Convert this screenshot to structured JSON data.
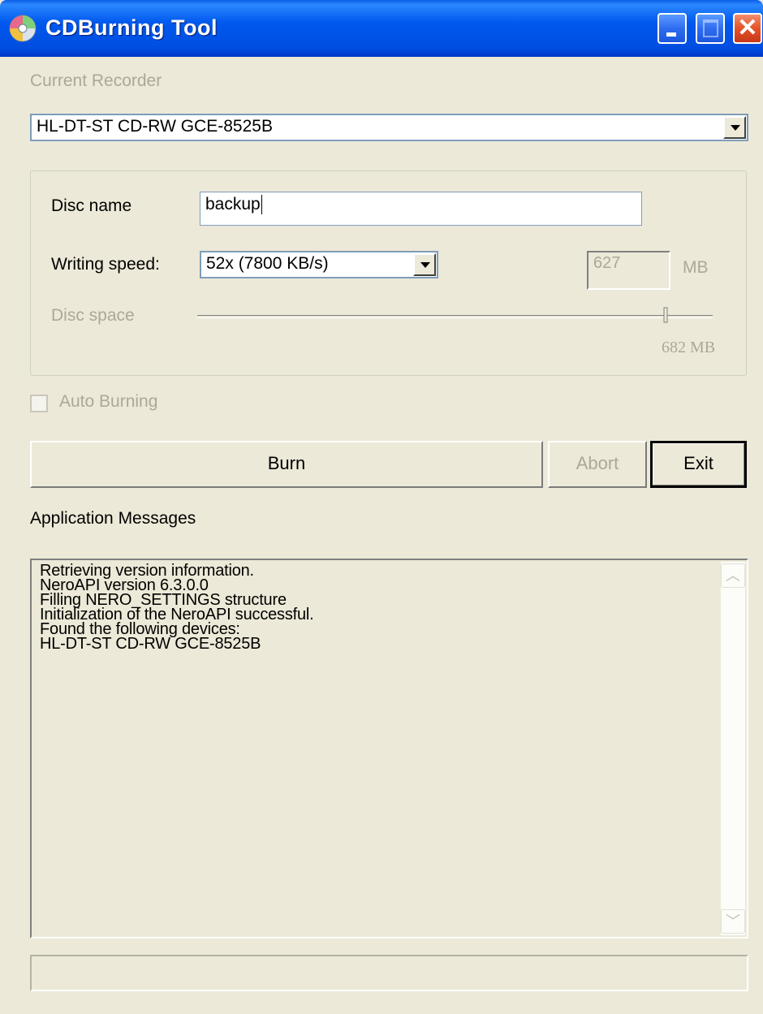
{
  "window": {
    "title": "CDBurning Tool",
    "icon": "cd-disc-icon",
    "controls": {
      "minimize": "minimize-icon",
      "maximize": "maximize-icon",
      "close": "close-icon"
    }
  },
  "recorder": {
    "label": "Current Recorder",
    "selected": "HL-DT-ST CD-RW GCE-8525B"
  },
  "settings": {
    "disc_name_label": "Disc name",
    "disc_name_value": "backup",
    "writing_speed_label": "Writing speed:",
    "writing_speed_selected": "52x (7800 KB/s)",
    "size_value": "627",
    "size_unit": "MB",
    "disc_space_label": "Disc space",
    "disc_space_value": "682 MB"
  },
  "auto_burning": {
    "label": "Auto Burning",
    "checked": false
  },
  "buttons": {
    "burn": "Burn",
    "abort": "Abort",
    "exit": "Exit"
  },
  "messages": {
    "label": "Application Messages",
    "lines": [
      "Retrieving version information.",
      "NeroAPI version 6.3.0.0",
      "Filling NERO_SETTINGS structure",
      "Initialization of the NeroAPI successful.",
      "Found the following devices:",
      "HL-DT-ST CD-RW GCE-8525B"
    ]
  },
  "status_text": ""
}
